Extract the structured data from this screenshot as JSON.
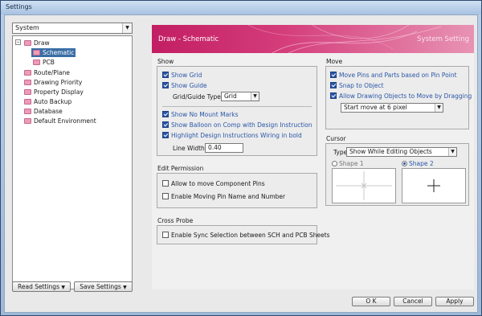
{
  "window": {
    "title": "Settings"
  },
  "left": {
    "category_select": "System",
    "tree": [
      {
        "label": "Draw",
        "expander": "−"
      },
      {
        "label": "Schematic"
      },
      {
        "label": "PCB"
      },
      {
        "label": "Route/Plane"
      },
      {
        "label": "Drawing Priority"
      },
      {
        "label": "Property Display"
      },
      {
        "label": "Auto Backup"
      },
      {
        "label": "Database"
      },
      {
        "label": "Default Environment"
      }
    ],
    "read_settings": "Read Settings",
    "save_settings": "Save Settings",
    "dropdown_arrow": "▼"
  },
  "banner": {
    "title": "Draw - Schematic",
    "subtitle": "System Setting"
  },
  "show": {
    "title": "Show",
    "show_grid": "Show Grid",
    "show_guide": "Show Guide",
    "grid_type_label": "Grid/Guide Type",
    "grid_type_value": "Grid",
    "no_mount": "Show No Mount Marks",
    "balloon": "Show Balloon on Comp with Design Instruction",
    "highlight": "Highlight Design Instructions Wiring in bold",
    "line_width_label": "Line Width",
    "line_width_value": "0.40"
  },
  "edit_permission": {
    "title": "Edit Permission",
    "allow_move": "Allow to move Component Pins",
    "enable_moving": "Enable Moving Pin Name and Number"
  },
  "cross_probe": {
    "title": "Cross Probe",
    "sync": "Enable Sync Selection between SCH and PCB Sheets"
  },
  "move": {
    "title": "Move",
    "move_pins": "Move Pins and Parts based on Pin Point",
    "snap": "Snap to Object",
    "allow_drag": "Allow Drawing Objects to Move by Dragging",
    "start_move": "Start move at 6 pixel"
  },
  "cursor": {
    "title": "Cursor",
    "type_label": "Type",
    "type_value": "Show While Editing Objects",
    "shape1": "Shape 1",
    "shape2": "Shape 2"
  },
  "footer": {
    "ok": "O K",
    "cancel": "Cancel",
    "apply": "Apply"
  },
  "colors": {
    "banner": "#c21e63",
    "accent": "#2a56a8",
    "selection": "#3a6ea5"
  }
}
